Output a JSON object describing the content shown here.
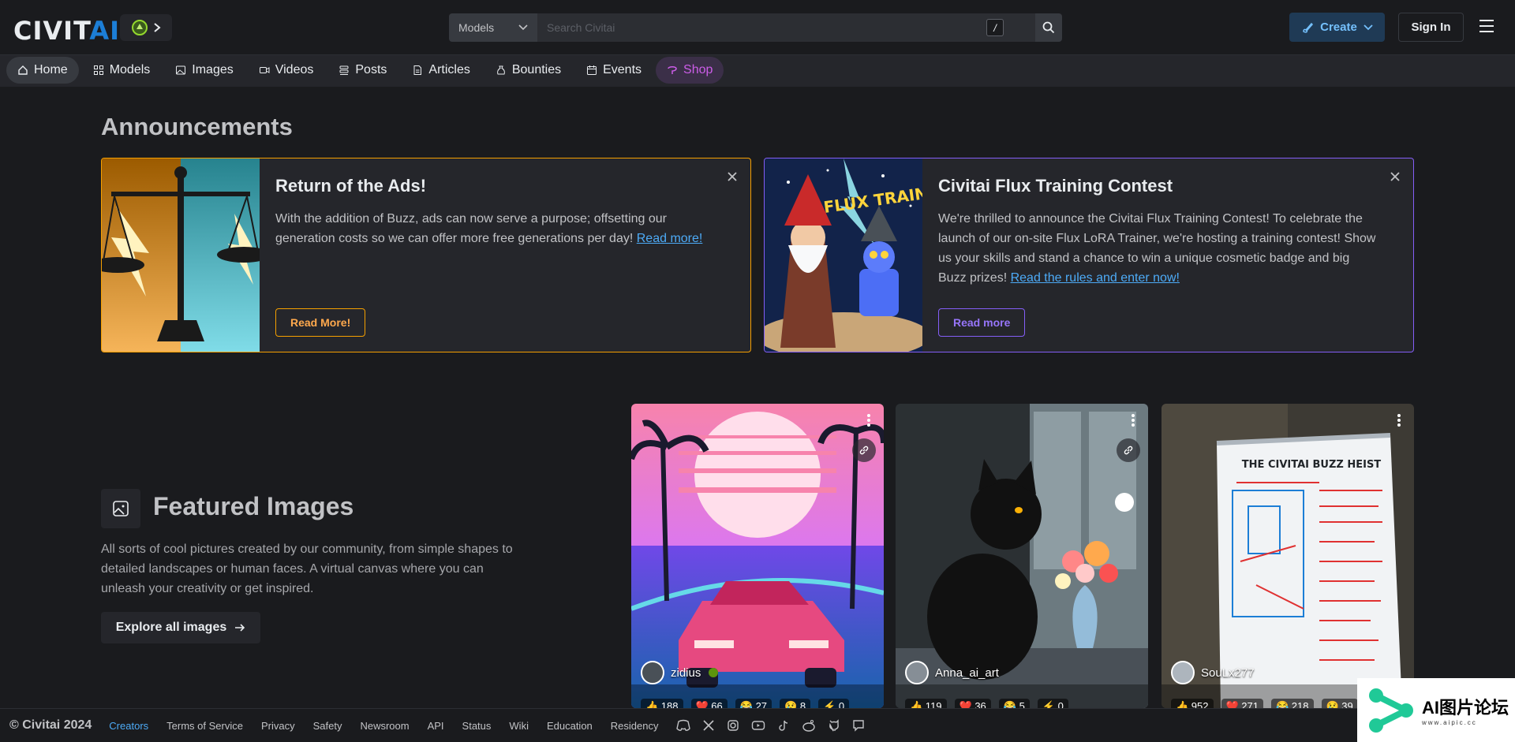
{
  "header": {
    "logo_left": "CIVIT",
    "logo_right": "AI",
    "search_category": "Models",
    "search_placeholder": "Search Civitai",
    "slash_key": "/",
    "create_label": "Create",
    "signin_label": "Sign In"
  },
  "nav": {
    "items": [
      {
        "label": "Home",
        "icon": "home-icon"
      },
      {
        "label": "Models",
        "icon": "grid-icon"
      },
      {
        "label": "Images",
        "icon": "photo-icon"
      },
      {
        "label": "Videos",
        "icon": "video-icon"
      },
      {
        "label": "Posts",
        "icon": "posts-icon"
      },
      {
        "label": "Articles",
        "icon": "file-text-icon"
      },
      {
        "label": "Bounties",
        "icon": "moneybag-icon"
      },
      {
        "label": "Events",
        "icon": "calendar-icon"
      },
      {
        "label": "Shop",
        "icon": "shop-icon"
      }
    ]
  },
  "announcements": {
    "title": "Announcements",
    "cards": [
      {
        "heading": "Return of the Ads!",
        "text": "With the addition of Buzz, ads can now serve a purpose; offsetting our generation costs so we can offer more free generations per day! ",
        "link": "Read more!",
        "button": "Read More!",
        "accent": "#f59f00"
      },
      {
        "heading": "Civitai Flux Training Contest",
        "text": "We're thrilled to announce the Civitai Flux Training Contest! To celebrate the launch of our on-site Flux LoRA Trainer, we're hosting a training contest! Show us your skills and stand a chance to win a unique cosmetic badge and big Buzz prizes! ",
        "link": "Read the rules and enter now!",
        "button": "Read more",
        "image_text": "FLUX TRAINING",
        "accent": "#845ef7"
      }
    ]
  },
  "featured": {
    "title": "Featured Images",
    "description": "All sorts of cool pictures created by our community, from simple shapes to detailed landscapes or human faces. A virtual canvas where you can unleash your creativity or get inspired.",
    "explore_label": "Explore all images",
    "images": [
      {
        "user": "zidius",
        "reactions": [
          "👍 188",
          "❤️ 66",
          "😂 27",
          "😢 8",
          "⚡ 0"
        ]
      },
      {
        "user": "Anna_ai_art",
        "reactions": [
          "👍 119",
          "❤️ 36",
          "😂 5",
          "⚡ 0"
        ]
      },
      {
        "user": "SouLx277",
        "reactions": [
          "👍 952",
          "❤️ 271",
          "😂 218",
          "😢 39"
        ],
        "whiteboard_title": "THE CIVITAI BUZZ HEIST"
      }
    ]
  },
  "footer": {
    "copyright": "© Civitai 2024",
    "links": [
      "Creators",
      "Terms of Service",
      "Privacy",
      "Safety",
      "Newsroom",
      "API",
      "Status",
      "Wiki",
      "Education",
      "Residency"
    ]
  },
  "watermark": {
    "main": "AI图片论坛",
    "sub": "www.aipic.cc"
  },
  "colors": {
    "background": "#1a1b1e",
    "accent_blue": "#1c7ed6",
    "shop_purple": "#cc5de8"
  }
}
